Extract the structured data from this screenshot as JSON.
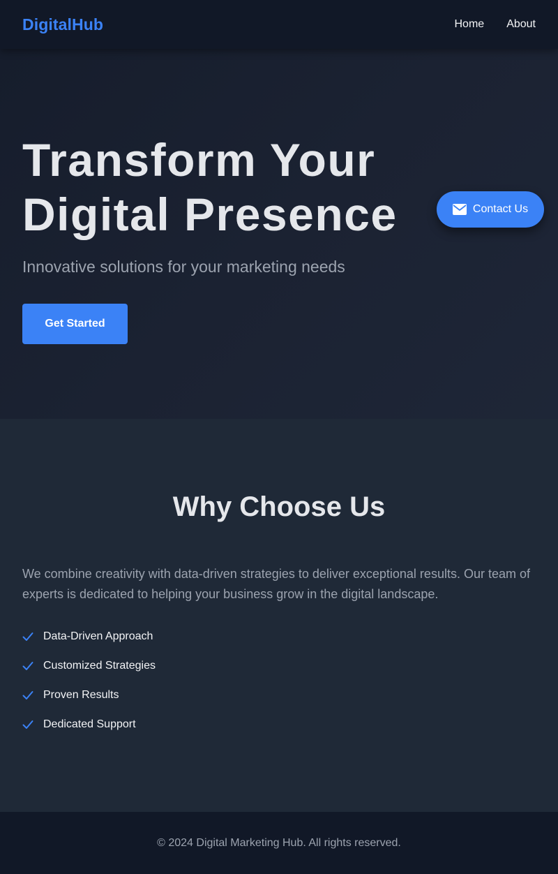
{
  "nav": {
    "logo": "DigitalHub",
    "links": [
      "Home",
      "About"
    ]
  },
  "hero": {
    "title_line1": "Transform Your",
    "title_line2": "Digital Presence",
    "subtitle": "Innovative solutions for your marketing needs",
    "cta_label": "Get Started"
  },
  "contact": {
    "label": "Contact Us",
    "icon": "envelope-icon"
  },
  "why": {
    "title": "Why Choose Us",
    "text": "We combine creativity with data-driven strategies to deliver exceptional results. Our team of experts is dedicated to helping your business grow in the digital landscape.",
    "features": [
      "Data-Driven Approach",
      "Customized Strategies",
      "Proven Results",
      "Dedicated Support"
    ],
    "feature_icon": "check-icon"
  },
  "footer": {
    "text": "© 2024 Digital Marketing Hub. All rights reserved."
  },
  "colors": {
    "accent": "#3b82f6",
    "nav_background": "#111827",
    "section_background": "#1f2937",
    "heading_text": "#e5e7eb",
    "muted_text": "#9ca3af"
  }
}
